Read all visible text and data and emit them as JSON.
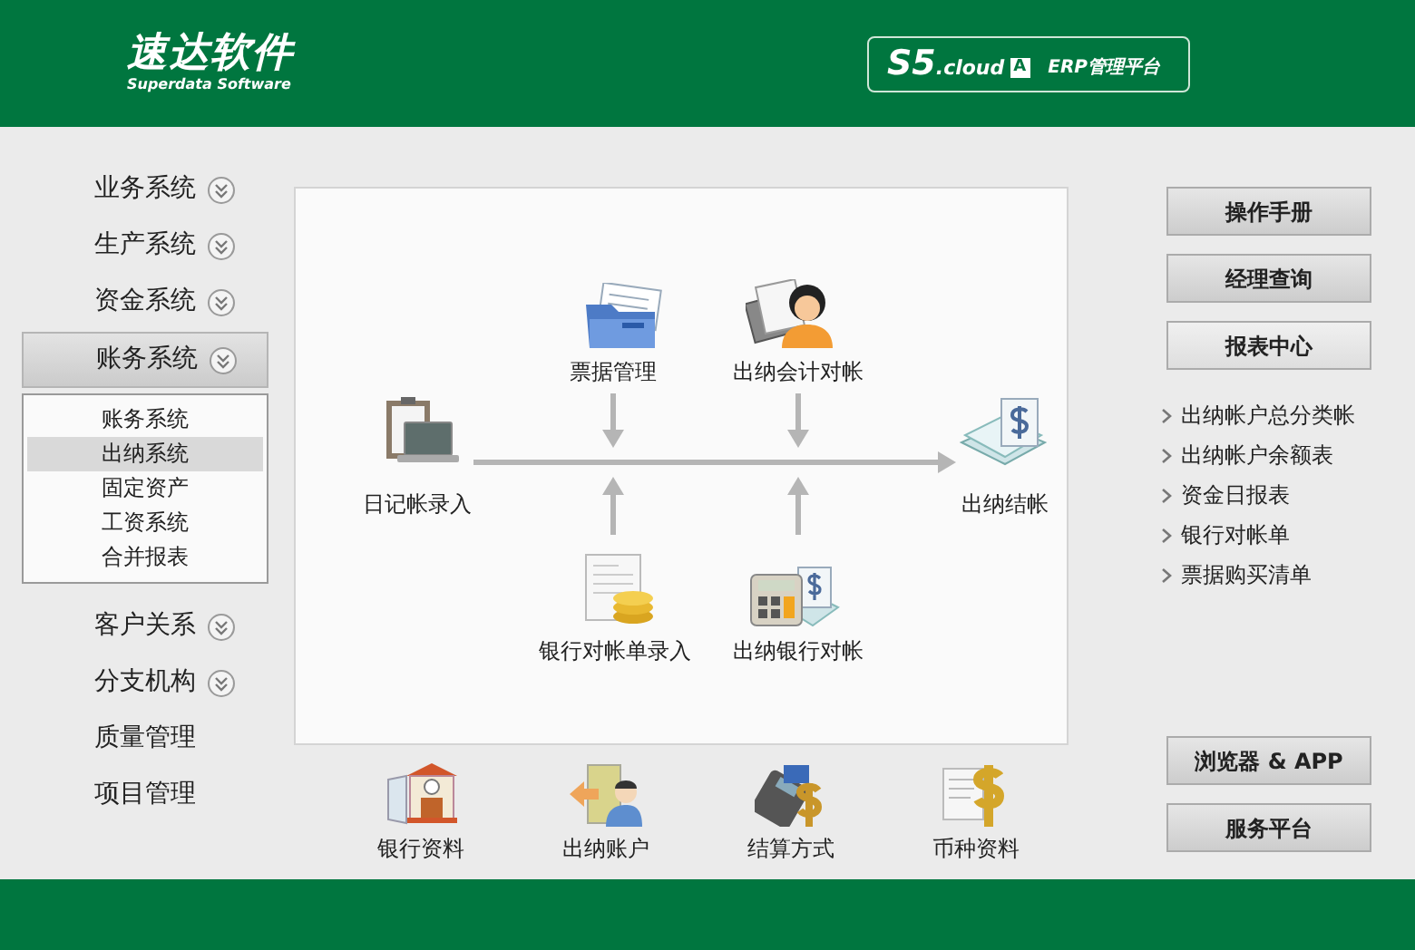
{
  "header": {
    "logo_title": "速达软件",
    "logo_subtitle": "Superdata Software",
    "product": {
      "name": "S5",
      "suffix": ".cloud",
      "edition": "A",
      "label": "ERP管理平台"
    }
  },
  "sidebar": {
    "items": [
      {
        "label": "业务系统",
        "kind": "group",
        "selected": false
      },
      {
        "label": "生产系统",
        "kind": "group",
        "selected": false
      },
      {
        "label": "资金系统",
        "kind": "group",
        "selected": false
      },
      {
        "label": "账务系统",
        "kind": "group",
        "selected": true,
        "children": [
          {
            "label": "账务系统",
            "selected": false
          },
          {
            "label": "出纳系统",
            "selected": true
          },
          {
            "label": "固定资产",
            "selected": false
          },
          {
            "label": "工资系统",
            "selected": false
          },
          {
            "label": "合并报表",
            "selected": false
          }
        ]
      },
      {
        "label": "客户关系",
        "kind": "group",
        "selected": false
      },
      {
        "label": "分支机构",
        "kind": "group",
        "selected": false
      },
      {
        "label": "质量管理",
        "kind": "link",
        "selected": false
      },
      {
        "label": "项目管理",
        "kind": "link",
        "selected": false
      }
    ]
  },
  "diagram": {
    "nodes": [
      {
        "label": "日记帐录入"
      },
      {
        "label": "票据管理"
      },
      {
        "label": "出纳会计对帐"
      },
      {
        "label": "出纳结帐"
      },
      {
        "label": "银行对帐单录入"
      },
      {
        "label": "出纳银行对帐"
      }
    ]
  },
  "shortcuts": [
    {
      "label": "银行资料"
    },
    {
      "label": "出纳账户"
    },
    {
      "label": "结算方式"
    },
    {
      "label": "币种资料"
    }
  ],
  "right_panel": {
    "top_buttons": [
      "操作手册",
      "经理查询",
      "报表中心"
    ],
    "report_links": [
      "出纳帐户总分类帐",
      "出纳帐户余额表",
      "资金日报表",
      "银行对帐单",
      "票据购买清单"
    ],
    "bottom_buttons": [
      "浏览器 & APP",
      "服务平台"
    ]
  }
}
